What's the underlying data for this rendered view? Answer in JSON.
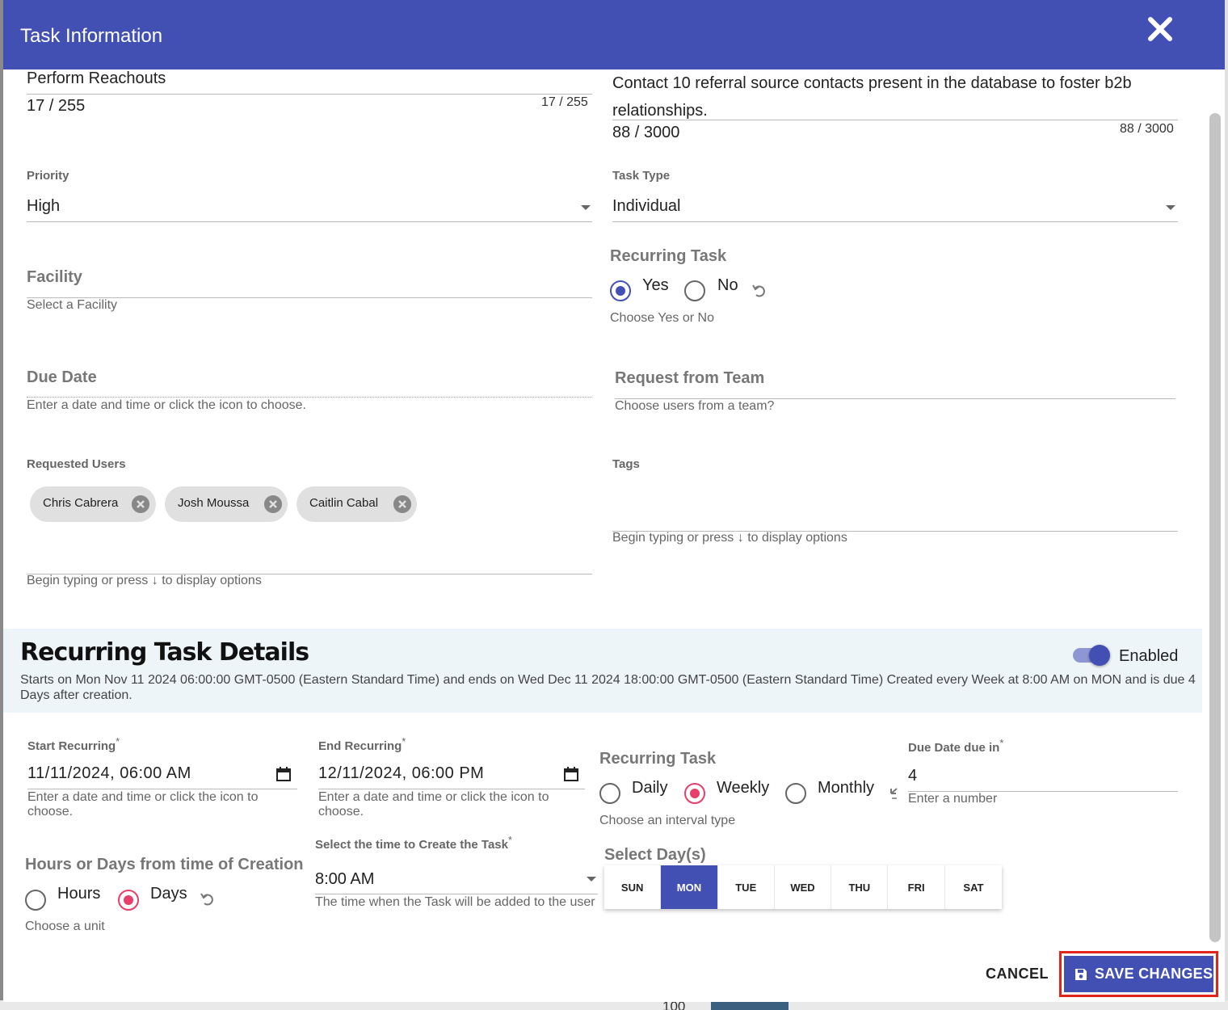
{
  "dialog": {
    "title": "Task Information"
  },
  "task": {
    "name": "Perform Reachouts",
    "name_count_left": "17 / 255",
    "name_count_right": "17 / 255",
    "description": "Contact 10 referral source contacts present in the database to foster b2b relationships.",
    "description_count_left": "88 / 3000",
    "description_count_right": "88 / 3000"
  },
  "priority": {
    "label": "Priority",
    "value": "High"
  },
  "task_type": {
    "label": "Task Type",
    "value": "Individual"
  },
  "recurring_choice": {
    "label": "Recurring Task",
    "options": [
      "Yes",
      "No"
    ],
    "selected": "Yes",
    "helper": "Choose Yes or No"
  },
  "facility": {
    "label": "Facility",
    "placeholder": "Select a Facility"
  },
  "due_date": {
    "label": "Due Date",
    "helper": "Enter a date and time or click the icon to choose."
  },
  "request_team": {
    "label": "Request from Team",
    "helper": "Choose users from a team?"
  },
  "requested_users": {
    "label": "Requested Users",
    "chips": [
      "Chris Cabrera",
      "Josh Moussa",
      "Caitlin Cabal"
    ],
    "helper": "Begin typing or press ↓ to display options"
  },
  "tags": {
    "label": "Tags",
    "helper": "Begin typing or press ↓ to display options"
  },
  "recurring_details": {
    "title": "Recurring Task Details",
    "toggle_label": "Enabled",
    "toggle_on": true,
    "description": "Starts on Mon Nov 11 2024 06:00:00 GMT-0500 (Eastern Standard Time) and ends on Wed Dec 11 2024 18:00:00 GMT-0500 (Eastern Standard Time) Created every Week at 8:00 AM on MON and is due 4 Days after creation."
  },
  "start_recurring": {
    "label": "Start Recurring",
    "required": "*",
    "value": "11/11/2024, 06:00 AM",
    "helper": "Enter a date and time or click the icon to choose."
  },
  "end_recurring": {
    "label": "End Recurring",
    "required": "*",
    "value": "12/11/2024, 06:00 PM",
    "helper": "Enter a date and time or click the icon to choose."
  },
  "interval": {
    "label": "Recurring Task",
    "options": [
      "Daily",
      "Weekly",
      "Monthly"
    ],
    "selected": "Weekly",
    "helper": "Choose an interval type"
  },
  "due_in": {
    "label": "Due Date due in",
    "required": "*",
    "value": "4",
    "helper": "Enter a number"
  },
  "unit": {
    "label": "Hours or Days from time of Creation",
    "options": [
      "Hours",
      "Days"
    ],
    "selected": "Days",
    "helper": "Choose a unit"
  },
  "create_time": {
    "label": "Select the time to Create the Task",
    "required": "*",
    "value": "8:00 AM",
    "helper": "The time when the Task will be added to the user"
  },
  "days": {
    "label": "Select Day(s)",
    "options": [
      "SUN",
      "MON",
      "TUE",
      "WED",
      "THU",
      "FRI",
      "SAT"
    ],
    "selected": "MON"
  },
  "actions": {
    "cancel": "CANCEL",
    "save": "SAVE CHANGES"
  },
  "background": {
    "axis_number": "100"
  },
  "colors": {
    "primary": "#4350b3",
    "accent_pink": "#e63f6b",
    "highlight_red": "#e3241b"
  }
}
